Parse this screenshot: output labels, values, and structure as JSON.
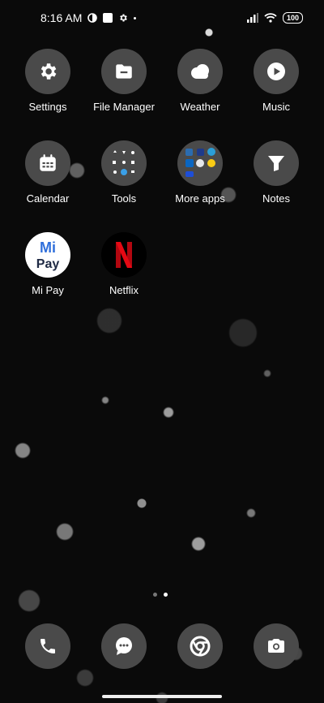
{
  "status": {
    "time": "8:16 AM",
    "battery": "100"
  },
  "apps": [
    {
      "label": "Settings",
      "icon": "gear-icon"
    },
    {
      "label": "File Manager",
      "icon": "folder-icon"
    },
    {
      "label": "Weather",
      "icon": "cloud-icon"
    },
    {
      "label": "Music",
      "icon": "play-icon"
    },
    {
      "label": "Calendar",
      "icon": "calendar-icon"
    },
    {
      "label": "Tools",
      "icon": "folder-icon"
    },
    {
      "label": "More apps",
      "icon": "folder-icon"
    },
    {
      "label": "Notes",
      "icon": "notes-icon"
    },
    {
      "label": "Mi Pay",
      "icon": "mi-pay-icon"
    },
    {
      "label": "Netflix",
      "icon": "netflix-icon"
    }
  ],
  "dock": [
    {
      "icon": "phone-icon"
    },
    {
      "icon": "message-icon"
    },
    {
      "icon": "chrome-icon"
    },
    {
      "icon": "camera-icon"
    }
  ],
  "pager": {
    "current_page": 2,
    "total_pages": 2
  },
  "colors": {
    "background": "#0a0a0a",
    "icon_circle": "#4a4a4a",
    "netflix_red": "#e50914",
    "mipay_blue": "#2f6fdb"
  }
}
